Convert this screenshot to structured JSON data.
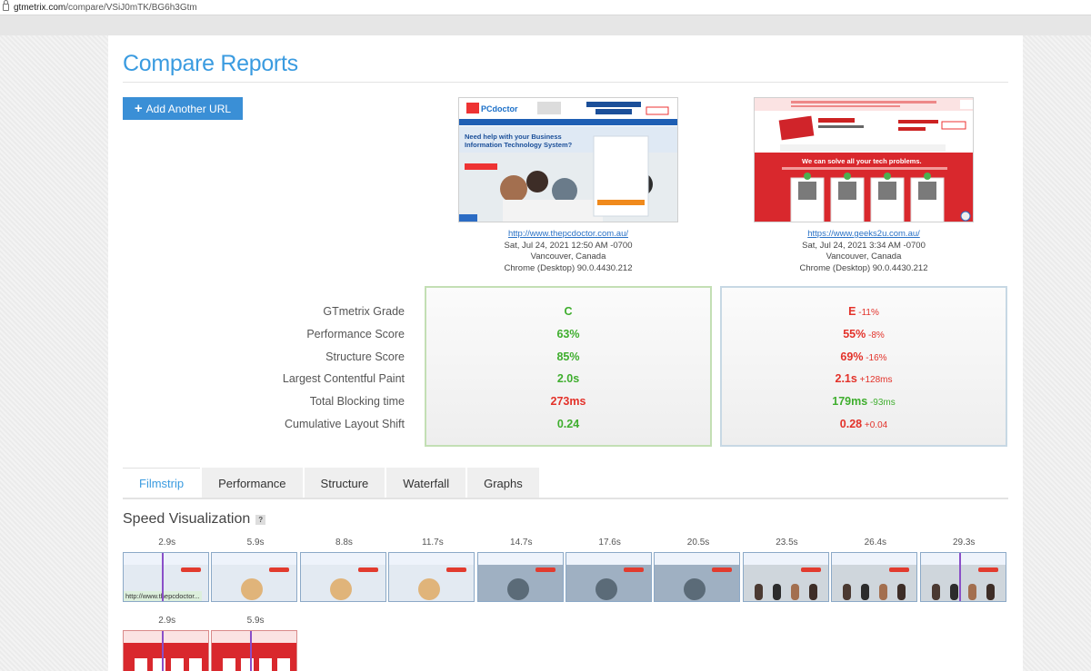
{
  "browser": {
    "url_host": "gtmetrix.com",
    "url_path": "/compare/VSiJ0mTK/BG6h3Gtm"
  },
  "page": {
    "title": "Compare Reports"
  },
  "actions": {
    "add_url_label": "Add Another URL"
  },
  "reports": [
    {
      "url": "http://www.thepcdoctor.com.au/",
      "date": "Sat, Jul 24, 2021 12:50 AM -0700",
      "location": "Vancouver, Canada",
      "browser": "Chrome (Desktop) 90.0.4430.212",
      "thumb_caption": "Need help with your Business Information Technology System?",
      "thumb_brand": "PCdoctor"
    },
    {
      "url": "https://www.geeks2u.com.au/",
      "date": "Sat, Jul 24, 2021 3:34 AM -0700",
      "location": "Vancouver, Canada",
      "browser": "Chrome (Desktop) 90.0.4430.212",
      "thumb_caption": "We can solve all your tech problems.",
      "thumb_brand": "GEEKS2U"
    }
  ],
  "metrics": {
    "labels": [
      "GTmetrix Grade",
      "Performance Score",
      "Structure Score",
      "Largest Contentful Paint",
      "Total Blocking time",
      "Cumulative Layout Shift"
    ],
    "report1": [
      "C",
      "63%",
      "85%",
      "2.0s",
      "273ms",
      "0.24"
    ],
    "report1_status": [
      "good",
      "good",
      "good",
      "good",
      "bad",
      "good"
    ],
    "report2": [
      "E",
      "55%",
      "69%",
      "2.1s",
      "179ms",
      "0.28"
    ],
    "report2_status": [
      "bad",
      "bad",
      "bad",
      "bad",
      "good",
      "bad"
    ],
    "report2_delta": [
      "-11%",
      "-8%",
      "-16%",
      "+128ms",
      "-93ms",
      "+0.04"
    ]
  },
  "tabs": [
    {
      "label": "Filmstrip",
      "active": true
    },
    {
      "label": "Performance",
      "active": false
    },
    {
      "label": "Structure",
      "active": false
    },
    {
      "label": "Waterfall",
      "active": false
    },
    {
      "label": "Graphs",
      "active": false
    }
  ],
  "speed_visualization": {
    "title": "Speed Visualization",
    "help_label": "?",
    "row1_times": [
      "2.9s",
      "5.9s",
      "8.8s",
      "11.7s",
      "14.7s",
      "17.6s",
      "20.5s",
      "23.5s",
      "26.4s",
      "29.3s"
    ],
    "row1_caption": "http://www.thepcdoctor...",
    "row2_times": [
      "2.9s",
      "5.9s"
    ]
  },
  "colors": {
    "accent": "#3a9be0",
    "good": "#3fae2e",
    "bad": "#e3322a"
  }
}
